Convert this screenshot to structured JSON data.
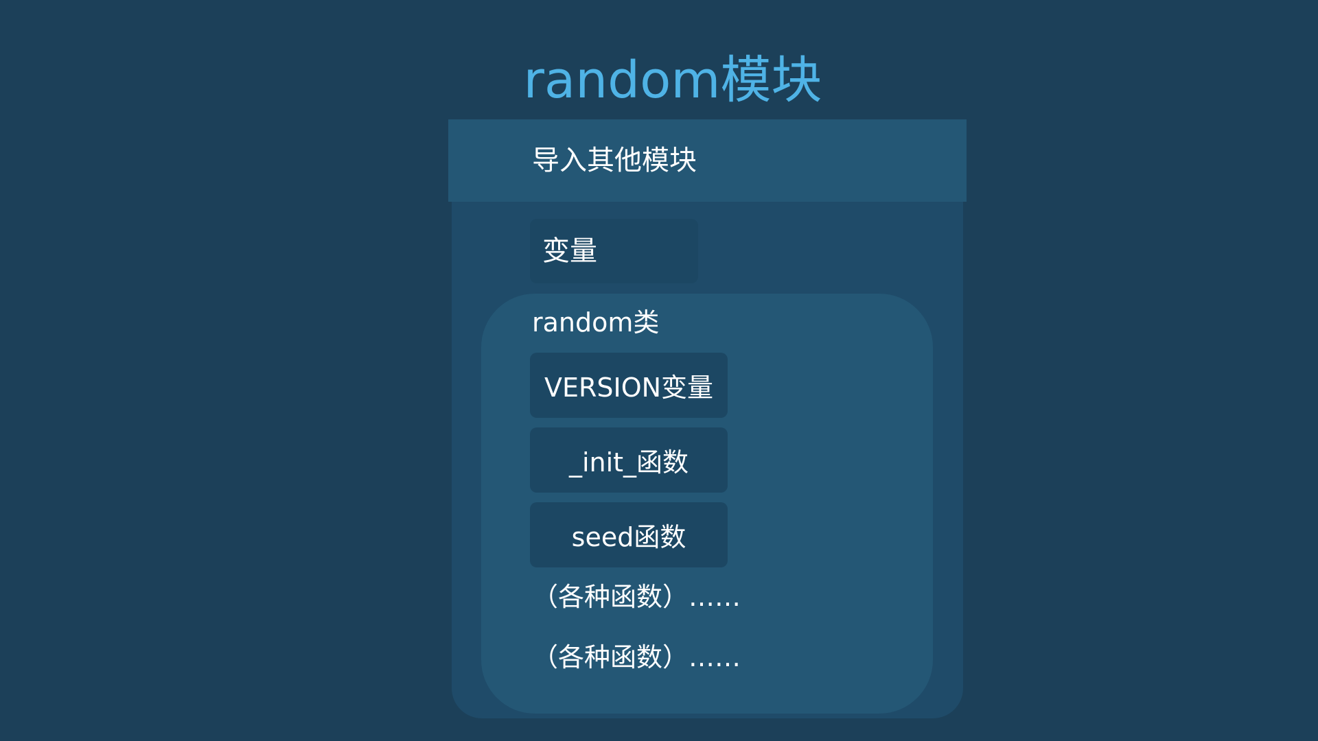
{
  "title": "random模块",
  "module": {
    "import_label": "导入其他模块",
    "variables_label": "变量",
    "class": {
      "name": "random类",
      "members": [
        "VERSION变量",
        "_init_函数",
        "seed函数"
      ],
      "more_items": [
        "（各种函数）……",
        "（各种函数）……"
      ]
    }
  }
}
